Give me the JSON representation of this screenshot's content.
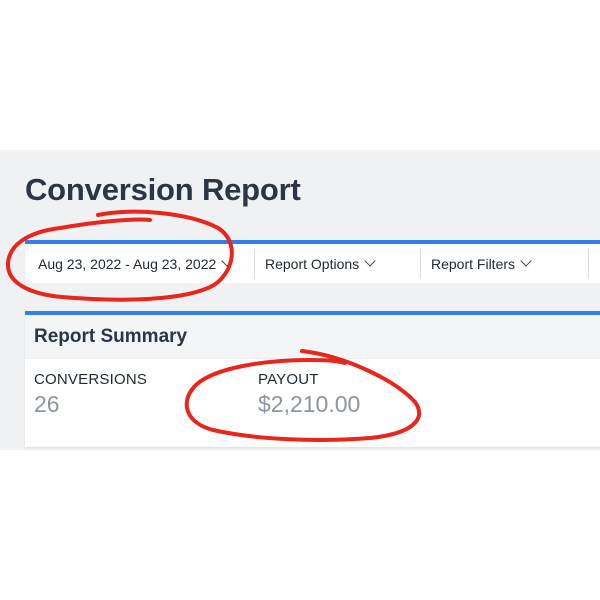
{
  "page": {
    "title": "Conversion Report"
  },
  "toolbar": {
    "date_range": "Aug 23, 2022 - Aug 23, 2022",
    "report_options": "Report Options",
    "report_filters": "Report Filters"
  },
  "summary": {
    "title": "Report Summary",
    "metrics": [
      {
        "label": "CONVERSIONS",
        "value": "26"
      },
      {
        "label": "PAYOUT",
        "value": "$2,210.00"
      }
    ]
  },
  "colors": {
    "accent": "#2f80ed",
    "annotation": "#e8261c",
    "title_text": "#2b3544",
    "metric_value": "#8e959e"
  }
}
